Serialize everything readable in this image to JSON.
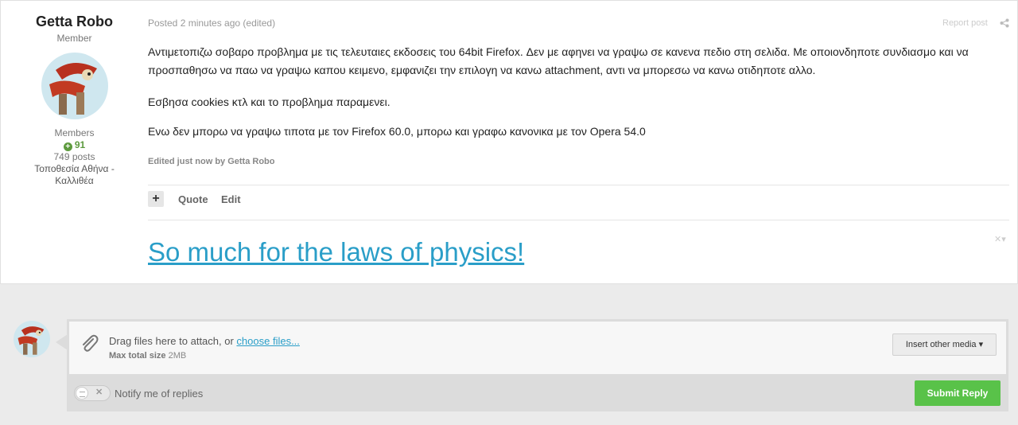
{
  "author": {
    "name": "Getta Robo",
    "title": "Member",
    "group": "Members",
    "reputation": "91",
    "posts": "749 posts",
    "location": "Τοποθεσία Αθήνα - Καλλιθέα"
  },
  "post": {
    "meta": "Posted 2 minutes ago (edited)",
    "report": "Report post",
    "paragraphs": [
      "Αντιμετοπιζω σοβαρο προβλημα με τις τελευταιες εκδοσεις του 64bit Firefox. Δεν με αφηνει να γραψω σε κανενα πεδιο στη σελιδα. Με οποιονδηποτε συνδιασμο και να προσπαθησω να παω να γραψω καπου κειμενο, εμφανιζει την επιλογη να κανω attachment, αντι να μπορεσω να κανω οτιδηποτε αλλο.",
      "Εσβησα cookies κτλ και το προβλημα παραμενει.",
      "Ενω δεν μπορω να γραψω τιποτα με τον Firefox 60.0, μπορω και γραφω κανονικα με τον Opera 54.0"
    ],
    "edited_note": "Edited just now by Getta Robo",
    "plus_label": "+",
    "quote_label": "Quote",
    "edit_label": "Edit",
    "signature": "So much for the laws of physics!"
  },
  "reply": {
    "drag_text": "Drag files here to attach, or ",
    "choose_files": "choose files...",
    "max_size_label": "Max total size",
    "max_size_value": "2MB",
    "insert_media": "Insert other media",
    "notify": "Notify me of replies",
    "submit": "Submit Reply"
  },
  "colors": {
    "accent_link": "#2a9ec8",
    "submit_green": "#59c249",
    "reputation_green": "#5d9a3e"
  },
  "icons": [
    "plus-circle-icon",
    "share-icon",
    "paperclip-icon",
    "caret-down-icon",
    "close-icon"
  ]
}
